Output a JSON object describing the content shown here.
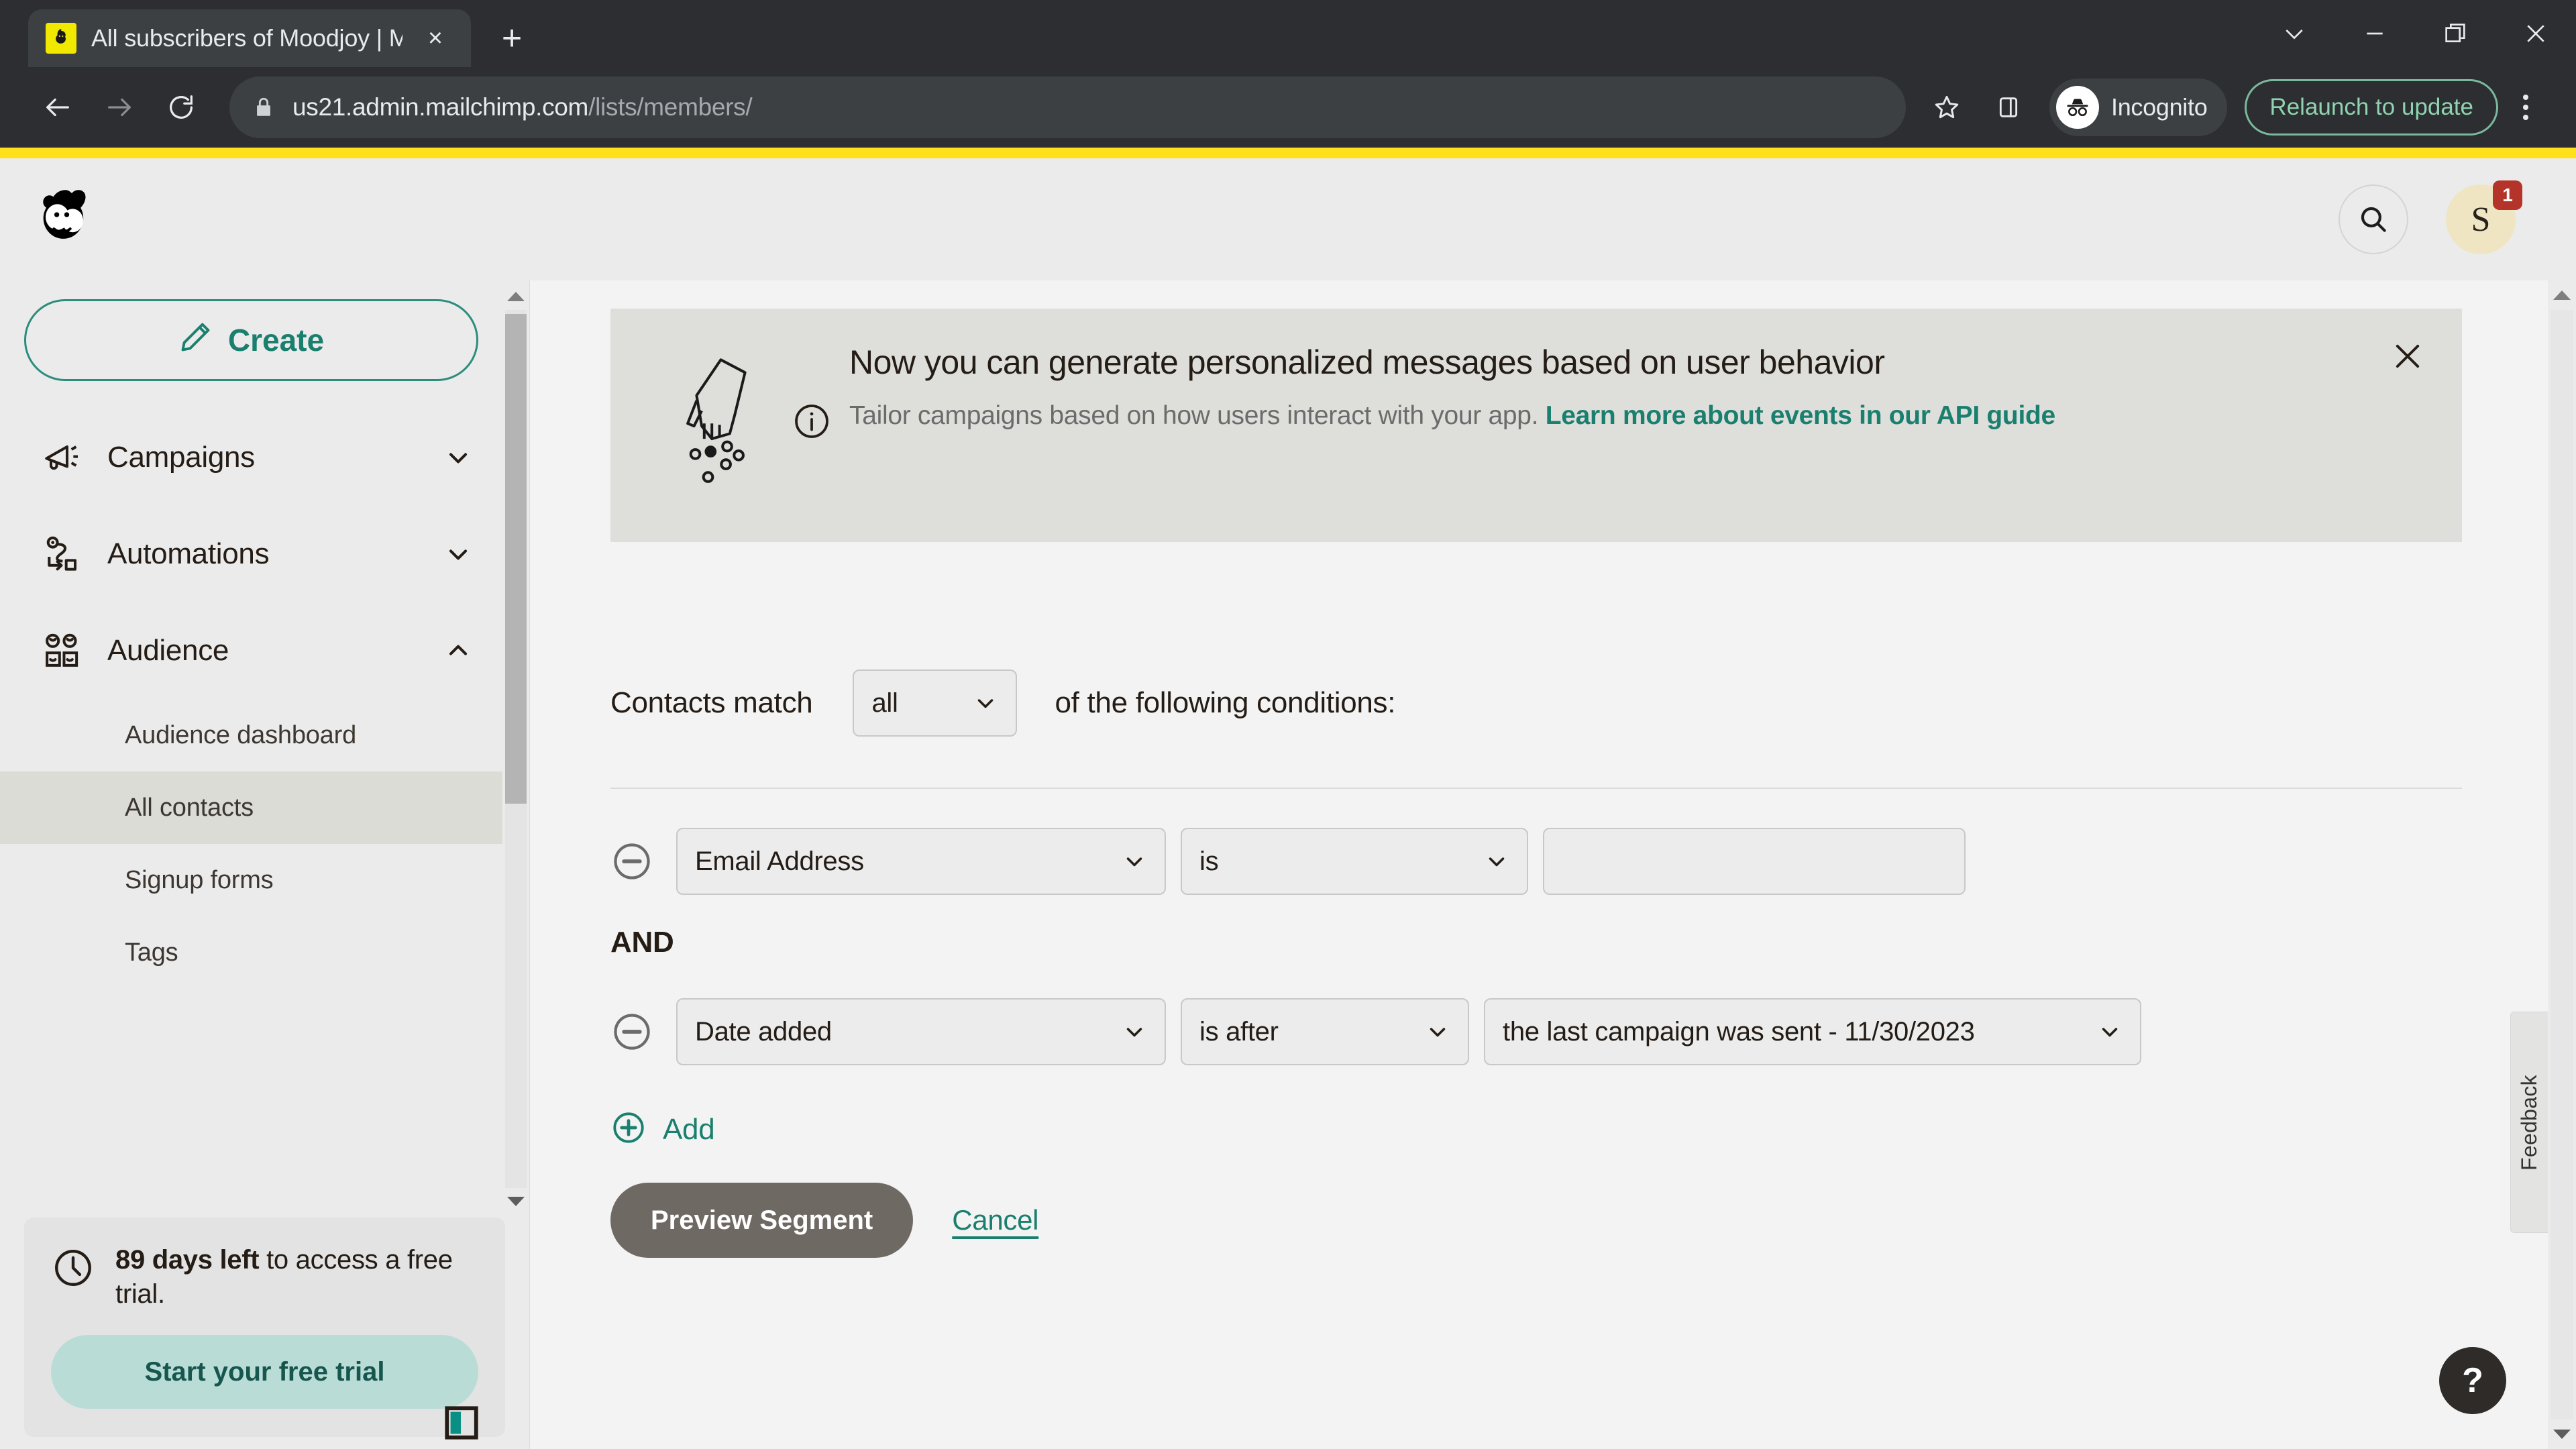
{
  "browser": {
    "tab": {
      "title": "All subscribers of Moodjoy | Mai",
      "favicon": "mailchimp-favicon",
      "close_label": "×"
    },
    "new_tab_label": "+",
    "window_controls": [
      "chevron-down",
      "minimize",
      "restore",
      "close"
    ],
    "url_host": "us21.admin.mailchimp.com",
    "url_path": "/lists/members/",
    "incognito_label": "Incognito",
    "relaunch_label": "Relaunch to update",
    "nav": {
      "back": "back-arrow",
      "forward": "forward-arrow",
      "reload": "reload"
    }
  },
  "header": {
    "logo": "mailchimp-freddie-logo",
    "search_icon": "search-icon",
    "avatar_initial": "S",
    "avatar_badge": "1"
  },
  "sidebar": {
    "create_label": "Create",
    "nav": [
      {
        "label": "Campaigns",
        "icon": "megaphone-icon",
        "expanded": false
      },
      {
        "label": "Automations",
        "icon": "automation-path-icon",
        "expanded": false
      },
      {
        "label": "Audience",
        "icon": "audience-people-icon",
        "expanded": true
      }
    ],
    "audience_sub": [
      {
        "label": "Audience dashboard",
        "selected": false
      },
      {
        "label": "All contacts",
        "selected": true
      },
      {
        "label": "Signup forms",
        "selected": false
      },
      {
        "label": "Tags",
        "selected": false
      }
    ],
    "trial": {
      "icon": "clock-icon",
      "days_bold": "89 days left",
      "days_rest": " to access a free trial.",
      "button_label": "Start your free trial"
    },
    "collapse_icon": "collapse-sidebar-icon"
  },
  "promo": {
    "illustration": "hand-sprinkling-dots-illustration",
    "info_icon": "info-circle-icon",
    "title": "Now you can generate personalized messages based on user behavior",
    "subtitle": "Tailor campaigns based on how users interact with your app. ",
    "link_text": "Learn more about events in our API guide",
    "close_icon": "close-icon"
  },
  "segment_builder": {
    "match_prefix": "Contacts match",
    "match_value": "all",
    "match_suffix": "of the following conditions:",
    "and_label": "AND",
    "conditions": [
      {
        "remove_icon": "minus-circle-icon",
        "field": "Email Address",
        "operator": "is",
        "value": "",
        "value_type": "text-input"
      },
      {
        "remove_icon": "minus-circle-icon",
        "field": "Date added",
        "operator": "is after",
        "value": "the last campaign was sent - 11/30/2023",
        "value_type": "select"
      }
    ],
    "add_label": "Add",
    "add_icon": "plus-circle-icon",
    "preview_label": "Preview Segment",
    "cancel_label": "Cancel"
  },
  "right_rail": {
    "feedback_label": "Feedback",
    "help_label": "?"
  },
  "colors": {
    "brand_yellow": "#ffe01b",
    "teal": "#1a7f6e",
    "page_bg": "#f3f3f3",
    "sidebar_bg": "#ebebeb",
    "promo_bg": "#dedfdb",
    "button_grey": "#6f6963",
    "badge_red": "#b5342a"
  }
}
